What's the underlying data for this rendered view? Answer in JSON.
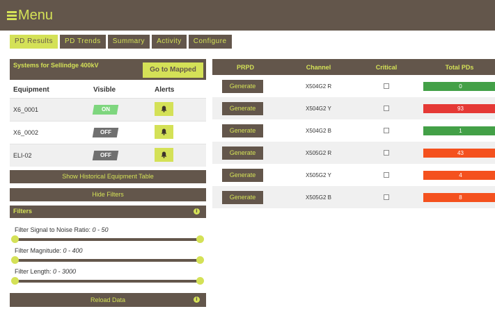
{
  "menu": {
    "label": "Menu"
  },
  "tabs": [
    {
      "label": "PD Results",
      "active": true
    },
    {
      "label": "PD Trends",
      "active": false
    },
    {
      "label": "Summary",
      "active": false
    },
    {
      "label": "Activity",
      "active": false
    },
    {
      "label": "Configure",
      "active": false
    }
  ],
  "systems": {
    "title": "Systems for Sellindge 400kV",
    "goto_label": "Go to Mapped"
  },
  "equipment_table": {
    "headers": [
      "Equipment",
      "Visible",
      "Alerts"
    ],
    "rows": [
      {
        "name": "X6_0001",
        "visible": "ON"
      },
      {
        "name": "X6_0002",
        "visible": "OFF"
      },
      {
        "name": "ELI-02",
        "visible": "OFF"
      }
    ]
  },
  "buttons": {
    "historical": "Show Historical Equipment Table",
    "hide_filters": "Hide Filters",
    "reload": "Reload Data"
  },
  "filters": {
    "title": "Filters",
    "items": [
      {
        "label": "Filter Signal to Noise Ratio: ",
        "range": "0 - 50",
        "min": 0,
        "max": 50
      },
      {
        "label": "Filter Magnitude: ",
        "range": "0 - 400",
        "min": 0,
        "max": 400
      },
      {
        "label": "Filter Length: ",
        "range": "0 - 3000",
        "min": 0,
        "max": 3000
      }
    ]
  },
  "pd_table": {
    "headers": [
      "PRPD",
      "Channel",
      "Critical",
      "Total PDs"
    ],
    "generate_label": "Generate",
    "rows": [
      {
        "channel": "X504G2 R",
        "critical": false,
        "total": "0",
        "color": "#43a047"
      },
      {
        "channel": "X504G2 Y",
        "critical": false,
        "total": "93",
        "color": "#e53935"
      },
      {
        "channel": "X504G2 B",
        "critical": false,
        "total": "1",
        "color": "#43a047"
      },
      {
        "channel": "X505G2 R",
        "critical": false,
        "total": "43",
        "color": "#f4511e"
      },
      {
        "channel": "X505G2 Y",
        "critical": false,
        "total": "4",
        "color": "#f4511e"
      },
      {
        "channel": "X505G2 B",
        "critical": false,
        "total": "8",
        "color": "#f4511e"
      }
    ]
  },
  "icons": {
    "menu": "hamburger-icon",
    "alert": "bell-icon",
    "info": "info-icon"
  },
  "colors": {
    "brand": "#63564b",
    "accent": "#d4e157",
    "on": "#7ed67e",
    "off": "#707070"
  }
}
